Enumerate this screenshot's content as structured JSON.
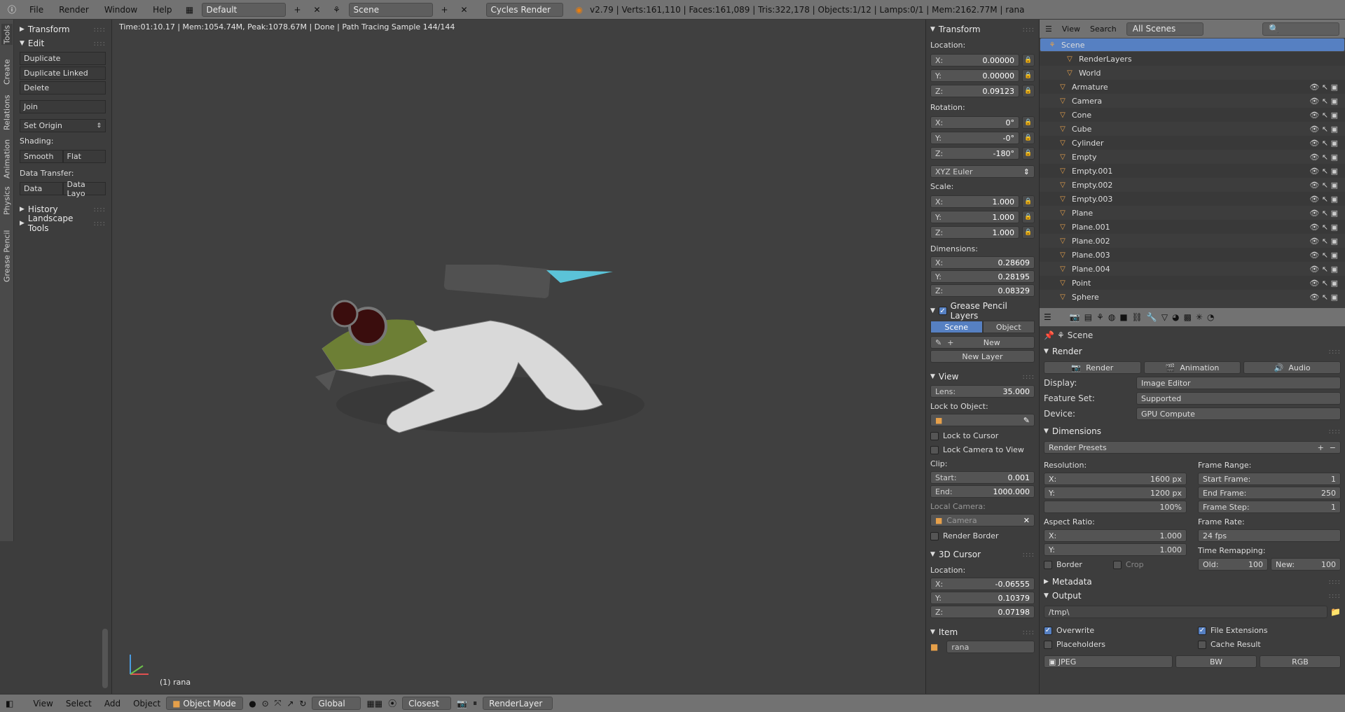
{
  "topbar": {
    "menus": [
      "File",
      "Render",
      "Window",
      "Help"
    ],
    "workspace": "Default",
    "scene": "Scene",
    "engine": "Cycles Render",
    "stats": "v2.79 | Verts:161,110 | Faces:161,089 | Tris:322,178 | Objects:1/12 | Lamps:0/1 | Mem:2162.77M | rana"
  },
  "left_tabs": [
    "Tools",
    "Create",
    "Relations",
    "Animation",
    "Physics",
    "Grease Pencil"
  ],
  "toolshelf": {
    "transform": "Transform",
    "edit": "Edit",
    "duplicate": "Duplicate",
    "duplicate_linked": "Duplicate Linked",
    "delete": "Delete",
    "join": "Join",
    "set_origin": "Set Origin",
    "shading": "Shading:",
    "smooth": "Smooth",
    "flat": "Flat",
    "data_transfer": "Data Transfer:",
    "data": "Data",
    "data_layo": "Data Layo",
    "history": "History",
    "landscape": "Landscape Tools"
  },
  "viewport": {
    "info": "Time:01:10.17 | Mem:1054.74M, Peak:1078.67M | Done | Path Tracing Sample 144/144",
    "object_label": "(1) rana"
  },
  "npanel": {
    "transform": "Transform",
    "location": "Location:",
    "loc": [
      [
        "X:",
        "0.00000"
      ],
      [
        "Y:",
        "0.00000"
      ],
      [
        "Z:",
        "0.09123"
      ]
    ],
    "rotation": "Rotation:",
    "rot": [
      [
        "X:",
        "0°"
      ],
      [
        "Y:",
        "-0°"
      ],
      [
        "Z:",
        "-180°"
      ]
    ],
    "euler": "XYZ Euler",
    "scale": "Scale:",
    "scl": [
      [
        "X:",
        "1.000"
      ],
      [
        "Y:",
        "1.000"
      ],
      [
        "Z:",
        "1.000"
      ]
    ],
    "dimensions": "Dimensions:",
    "dim": [
      [
        "X:",
        "0.28609"
      ],
      [
        "Y:",
        "0.28195"
      ],
      [
        "Z:",
        "0.08329"
      ]
    ],
    "gp_layers": "Grease Pencil Layers",
    "tab_scene": "Scene",
    "tab_object": "Object",
    "new": "New",
    "new_layer": "New Layer",
    "view": "View",
    "lens_k": "Lens:",
    "lens_v": "35.000",
    "lock_to_object": "Lock to Object:",
    "lock_to_cursor": "Lock to Cursor",
    "lock_camera": "Lock Camera to View",
    "clip": "Clip:",
    "clip_start_k": "Start:",
    "clip_start_v": "0.001",
    "clip_end_k": "End:",
    "clip_end_v": "1000.000",
    "local_camera": "Local Camera:",
    "camera": "Camera",
    "render_border": "Render Border",
    "cursor": "3D Cursor",
    "cursor_location": "Location:",
    "cur": [
      [
        "X:",
        "-0.06555"
      ],
      [
        "Y:",
        "0.10379"
      ],
      [
        "Z:",
        "0.07198"
      ]
    ],
    "item": "Item",
    "item_name": "rana"
  },
  "outliner": {
    "view": "View",
    "search": "Search",
    "filter": "All Scenes",
    "items": [
      "Scene",
      "RenderLayers",
      "World",
      "Armature",
      "Camera",
      "Cone",
      "Cube",
      "Cylinder",
      "Empty",
      "Empty.001",
      "Empty.002",
      "Empty.003",
      "Plane",
      "Plane.001",
      "Plane.002",
      "Plane.003",
      "Plane.004",
      "Point",
      "Sphere"
    ]
  },
  "properties": {
    "context": "Scene",
    "render": "Render",
    "render_btn": "Render",
    "animation_btn": "Animation",
    "audio_btn": "Audio",
    "display_k": "Display:",
    "display_v": "Image Editor",
    "feature_k": "Feature Set:",
    "feature_v": "Supported",
    "device_k": "Device:",
    "device_v": "GPU Compute",
    "dimensions": "Dimensions",
    "render_presets": "Render Presets",
    "resolution": "Resolution:",
    "res_x": "1600 px",
    "res_y": "1200 px",
    "res_pct": "100%",
    "frame_range": "Frame Range:",
    "start_frame_k": "Start Frame:",
    "start_frame_v": "1",
    "end_frame_k": "End Frame:",
    "end_frame_v": "250",
    "frame_step_k": "Frame Step:",
    "frame_step_v": "1",
    "aspect": "Aspect Ratio:",
    "asp_x": "1.000",
    "asp_y": "1.000",
    "frame_rate": "Frame Rate:",
    "fps": "24 fps",
    "time_remap": "Time Remapping:",
    "old_k": "Old:",
    "old_v": "100",
    "new_k": "New:",
    "new_v": "100",
    "border": "Border",
    "crop": "Crop",
    "metadata": "Metadata",
    "output": "Output",
    "path": "/tmp\\",
    "overwrite": "Overwrite",
    "file_ext": "File Extensions",
    "placeholders": "Placeholders",
    "cache_result": "Cache Result",
    "format": "JPEG",
    "bw": "BW",
    "rgb": "RGB"
  },
  "bottombar": {
    "view": "View",
    "select": "Select",
    "add": "Add",
    "object": "Object",
    "mode": "Object Mode",
    "orientation": "Global",
    "snap": "Closest",
    "renderlayer": "RenderLayer"
  },
  "colors": {
    "accent": "#5680c2",
    "header": "#727272",
    "panel": "#3d3d3d"
  }
}
